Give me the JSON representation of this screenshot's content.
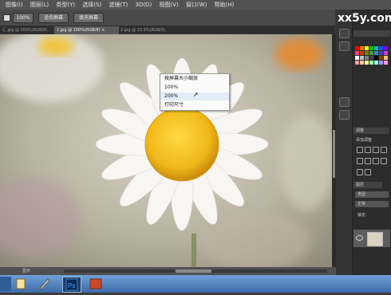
{
  "menubar": {
    "items": [
      "图像(I)",
      "图层(L)",
      "类型(Y)",
      "选择(S)",
      "滤镜(T)",
      "3D(D)",
      "视图(V)",
      "窗口(W)",
      "帮助(H)"
    ]
  },
  "options": {
    "zoom_value": "100%",
    "fit_screen_label": "适合屏幕",
    "fill_screen_label": "填充屏幕"
  },
  "tabs": [
    {
      "label": "汇.jpg @ 100%(RGB/8)",
      "active": false
    },
    {
      "label": "1.jpg @ 100%(RGB/8) ×",
      "active": true
    },
    {
      "label": "2.jpg @ 33.3%(RGB/8)",
      "active": false
    }
  ],
  "context_menu": {
    "items": [
      "按屏幕大小缩放",
      "100%",
      "200%",
      "打印尺寸"
    ],
    "highlighted_index": 2
  },
  "status": {
    "label": "显示"
  },
  "panels": {
    "adjustments_tab": "调整",
    "add_adjustment_label": "添加调整",
    "layers_tab": "图层",
    "kind_label": "类型",
    "blend_mode": "正常",
    "lock_label": "锁定:"
  },
  "watermark": "xx5y.com",
  "colors": {
    "ui_dark": "#3c3c3c",
    "menu_bg": "#535353",
    "taskbar": "#3e6ba8",
    "context_highlight": "#e3ecf7",
    "flower_yellow": "#f0b81a"
  },
  "icons": {
    "cursor": "pointer-cursor",
    "photoshop": "photoshop-taskbar-icon",
    "windows": "windows-start-icon"
  }
}
